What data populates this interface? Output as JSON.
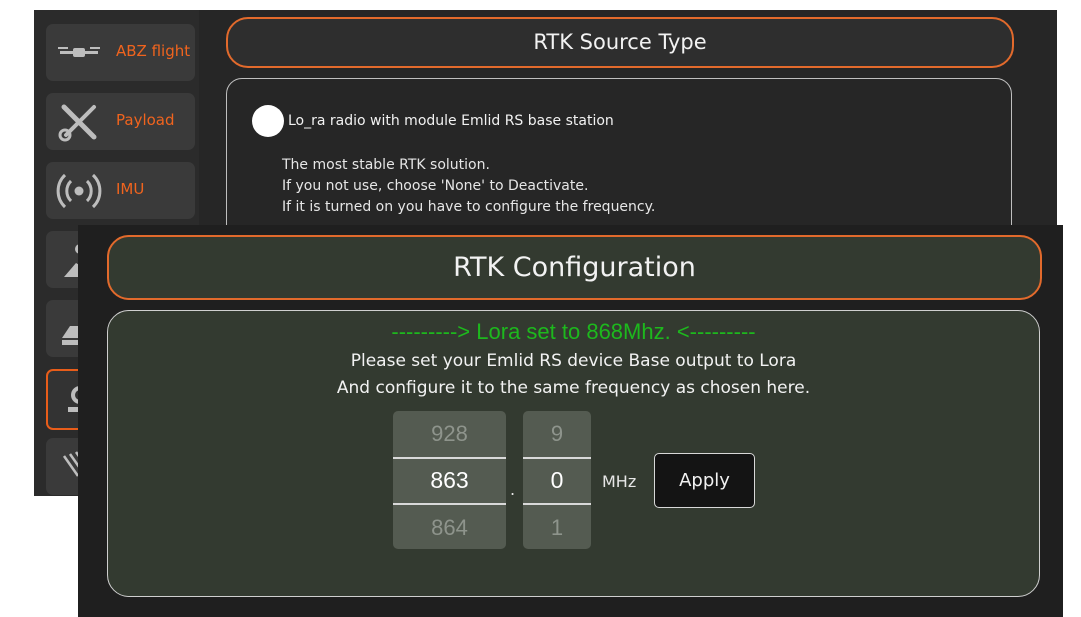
{
  "background_screen": {
    "sidebar": {
      "items": [
        {
          "label": "ABZ flight",
          "icon": "drone-icon"
        },
        {
          "label": "Payload",
          "icon": "tools-icon"
        },
        {
          "label": "IMU",
          "icon": "radio-signal-icon"
        },
        {
          "label": "",
          "icon": "settings-robot-icon"
        },
        {
          "label": "",
          "icon": "vehicle-icon"
        },
        {
          "label": "",
          "icon": "rtk-base-icon"
        },
        {
          "label": "",
          "icon": "sensor-icon"
        }
      ]
    },
    "title": "RTK Source Type",
    "option": {
      "label": "Lo_ra radio with module Emlid RS base station",
      "description": [
        "The most stable RTK solution.",
        "If you not use, choose 'None' to Deactivate.",
        "If it is turned on you have to configure the frequency."
      ]
    }
  },
  "config_panel": {
    "title": "RTK Configuration",
    "status": "---------> Lora set to 868Mhz. <---------",
    "instructions": [
      "Please set your Emlid RS device Base output to Lora",
      "And configure it to the same frequency as chosen here."
    ],
    "frequency_picker": {
      "integer": {
        "above": "928",
        "selected": "863",
        "below": "864"
      },
      "separator": ".",
      "decimal": {
        "above": "9",
        "selected": "0",
        "below": "1"
      },
      "unit": "MHz"
    },
    "apply_label": "Apply"
  },
  "colors": {
    "accent": "#e26a2c",
    "status_green": "#1db81d",
    "panel_bg": "#333a30"
  }
}
